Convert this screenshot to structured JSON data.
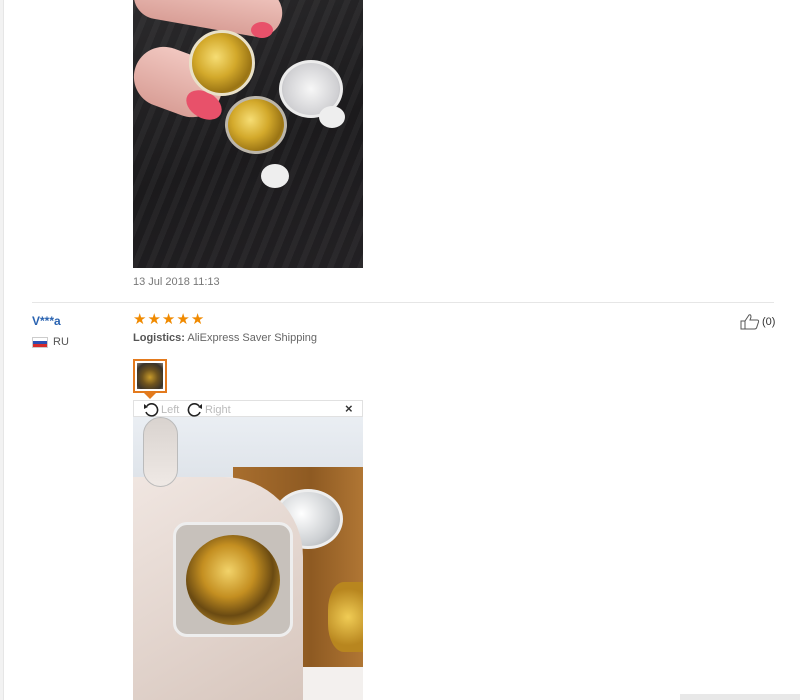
{
  "review_1": {
    "photo": "review-photo",
    "date": "13 Jul 2018 11:13"
  },
  "review_2": {
    "reviewer_name": "V***a",
    "country_code": "RU",
    "rating": 5,
    "stars": [
      "★",
      "★",
      "★",
      "★",
      "★"
    ],
    "logistics_label": "Logistics:",
    "logistics_value": "AliExpress Saver Shipping",
    "helpful_count": "(0)",
    "viewer": {
      "rotate_left_label": "Left",
      "rotate_right_label": "Right",
      "close_label": "×"
    }
  },
  "colors": {
    "accent": "#e37a1d",
    "star": "#f08a00",
    "link": "#2a63b1"
  },
  "icons": [
    "thumbs-up-icon",
    "rotate-left-icon",
    "rotate-right-icon",
    "close-icon",
    "flag-icon",
    "star-icon"
  ]
}
